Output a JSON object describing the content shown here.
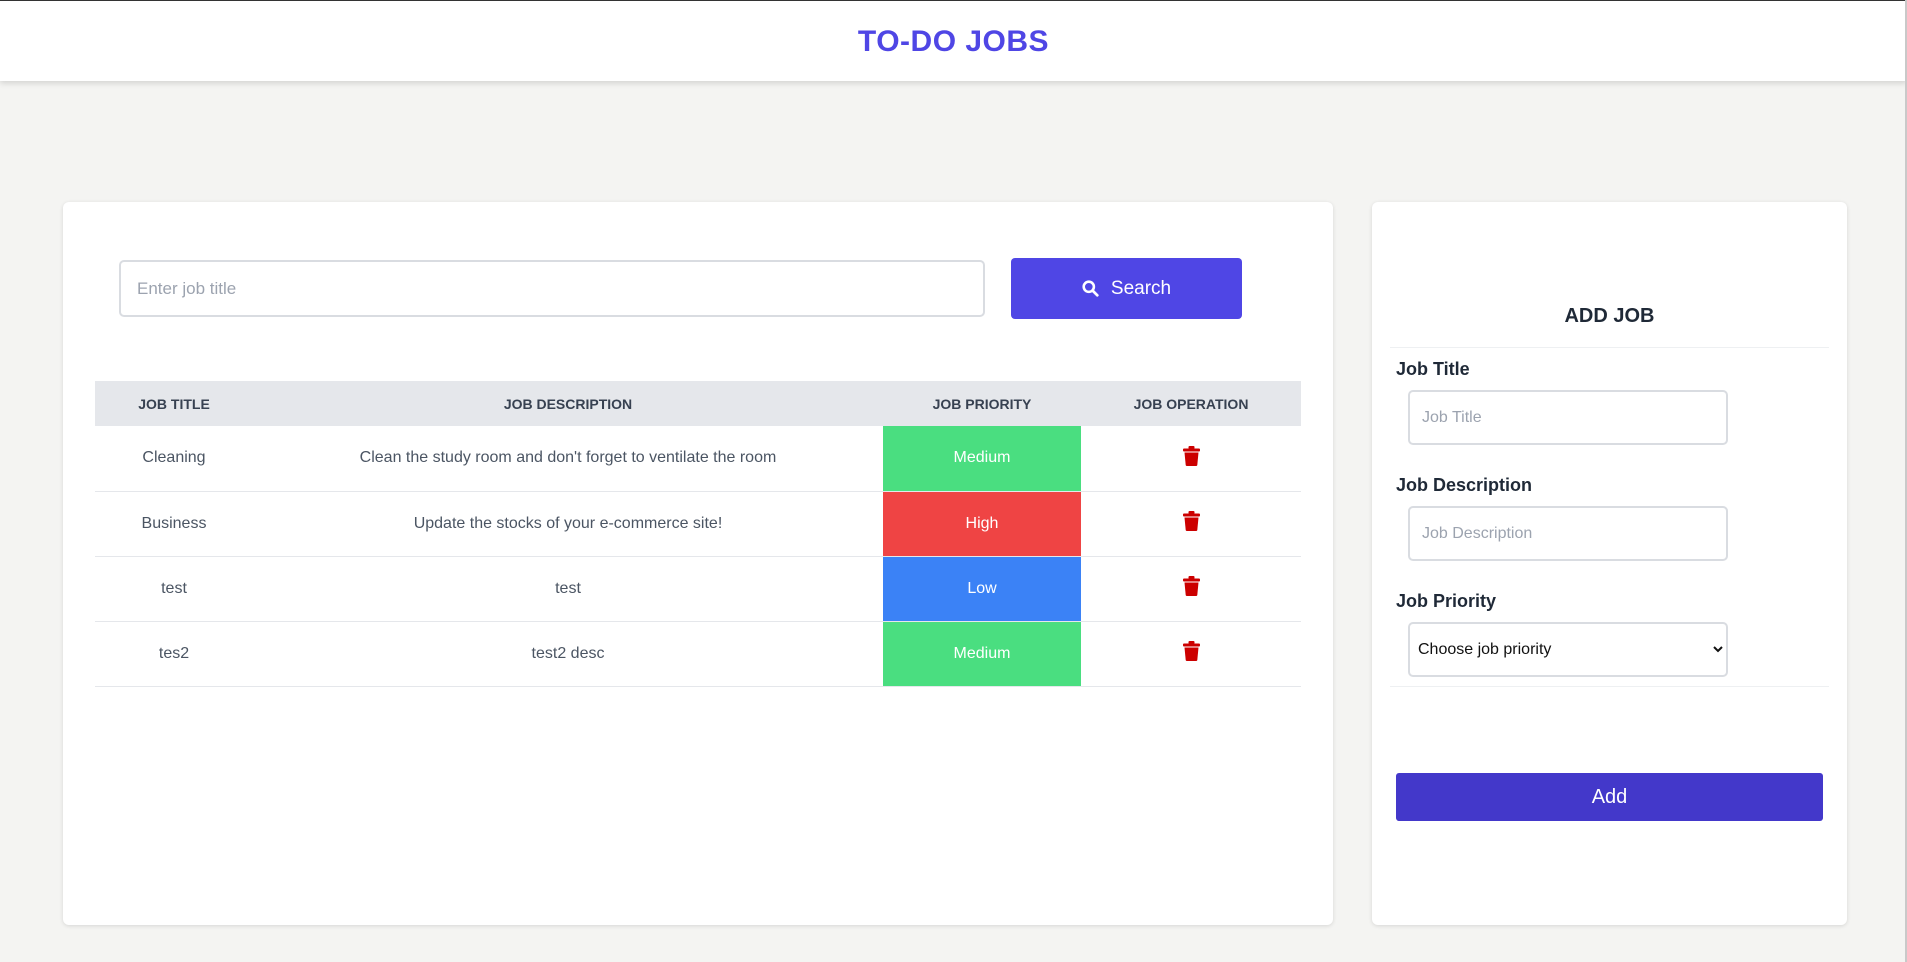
{
  "header": {
    "title": "TO-DO JOBS"
  },
  "search": {
    "placeholder": "Enter job title",
    "value": "",
    "button_label": "Search",
    "icon": "search-icon"
  },
  "table": {
    "headers": [
      "JOB TITLE",
      "JOB DESCRIPTION",
      "JOB PRIORITY",
      "JOB OPERATION"
    ],
    "rows": [
      {
        "title": "Cleaning",
        "description": "Clean the study room and don't forget to ventilate the room",
        "priority": "Medium"
      },
      {
        "title": "Business",
        "description": "Update the stocks of your e-commerce site!",
        "priority": "High"
      },
      {
        "title": "test",
        "description": "test",
        "priority": "Low"
      },
      {
        "title": "tes2",
        "description": "test2 desc",
        "priority": "Medium"
      }
    ],
    "operation_icon": "trash-icon"
  },
  "priority_colors": {
    "Low": "#3b82f6",
    "Medium": "#4ade80",
    "High": "#ef4444"
  },
  "colors": {
    "brand": "#4f46e5",
    "add_button": "#4338ca",
    "trash": "#cc0000"
  },
  "add_form": {
    "heading": "ADD JOB",
    "title_label": "Job Title",
    "title_placeholder": "Job Title",
    "description_label": "Job Description",
    "description_placeholder": "Job Description",
    "priority_label": "Job Priority",
    "priority_selected": "Choose job priority",
    "add_label": "Add"
  }
}
